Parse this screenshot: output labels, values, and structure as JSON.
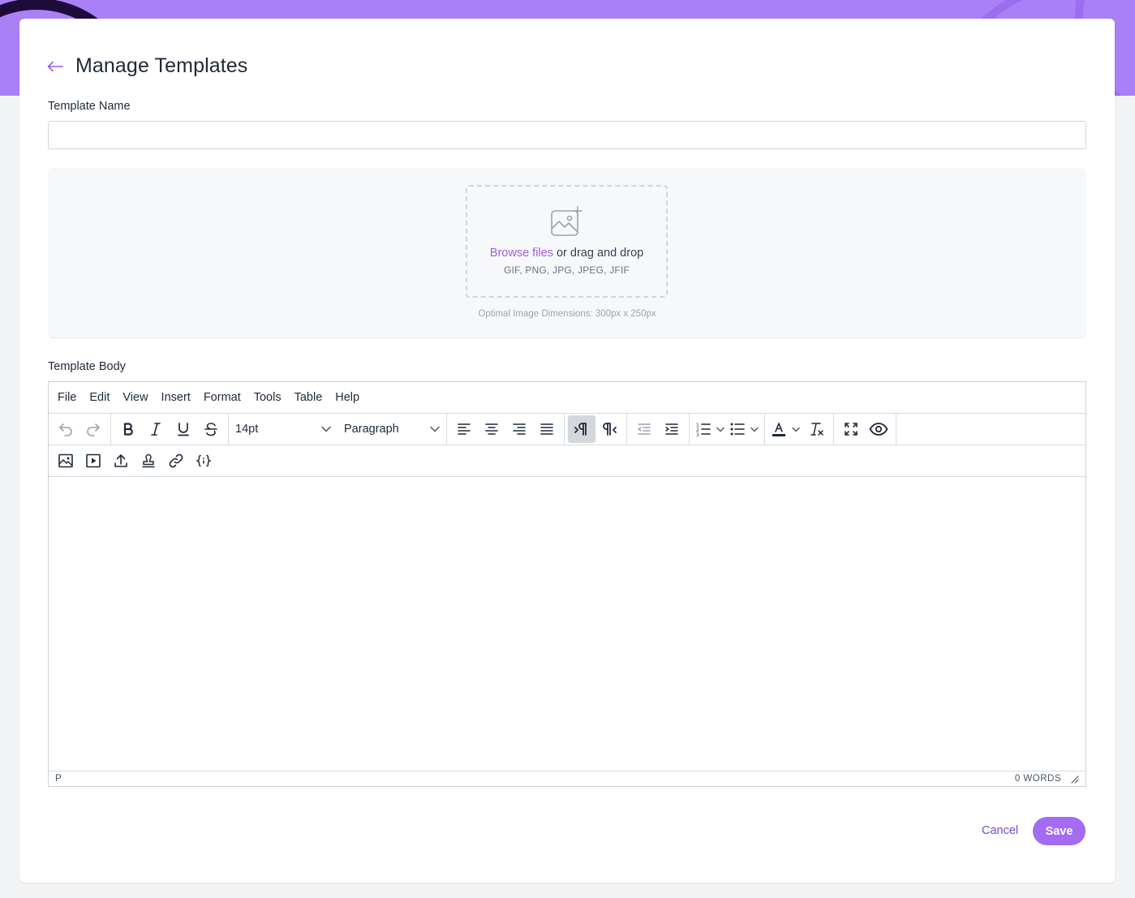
{
  "page": {
    "title": "Manage Templates",
    "accent_color": "#a980f5",
    "back_icon": "arrow-left-icon"
  },
  "template_name": {
    "label": "Template Name",
    "value": "",
    "placeholder": ""
  },
  "upload": {
    "browse_label": "Browse files",
    "drag_text": " or drag and drop",
    "file_types": "GIF, PNG, JPG, JPEG, JFIF",
    "dimensions_hint": "Optimal Image Dimensions: 300px x 250px",
    "icon": "image-add-icon"
  },
  "template_body": {
    "label": "Template Body",
    "menu": [
      "File",
      "Edit",
      "View",
      "Insert",
      "Format",
      "Tools",
      "Table",
      "Help"
    ],
    "font_size": "14pt",
    "block_format": "Paragraph",
    "toolbar_icons": [
      "undo-icon",
      "redo-icon",
      "bold-icon",
      "italic-icon",
      "underline-icon",
      "strikethrough-icon",
      "align-left-icon",
      "align-center-icon",
      "align-right-icon",
      "align-justify-icon",
      "ltr-icon",
      "rtl-icon",
      "outdent-icon",
      "indent-icon",
      "numbered-list-icon",
      "bulleted-list-icon",
      "text-color-icon",
      "clear-formatting-icon",
      "fullscreen-icon",
      "preview-icon"
    ],
    "toolbar2_icons": [
      "insert-image-icon",
      "insert-media-icon",
      "upload-icon",
      "stamp-icon",
      "link-icon",
      "variable-icon"
    ],
    "status_path": "P",
    "word_count": "0 WORDS"
  },
  "actions": {
    "cancel_label": "Cancel",
    "save_label": "Save"
  }
}
